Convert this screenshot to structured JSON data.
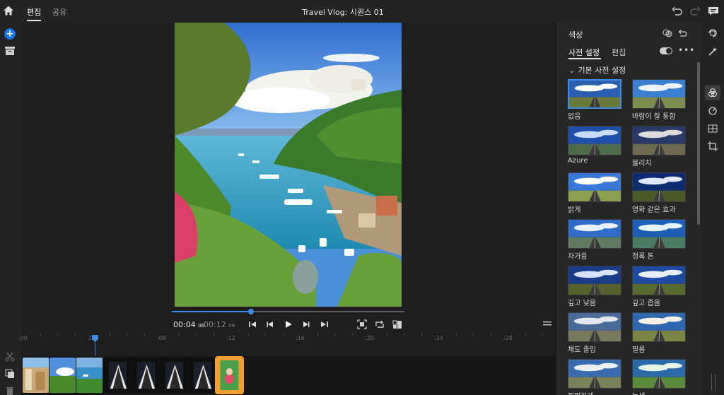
{
  "header": {
    "tabs": [
      {
        "label": "편집",
        "active": true
      },
      {
        "label": "공유",
        "active": false
      }
    ],
    "title": "Travel Vlog: 시퀀스 01"
  },
  "player": {
    "current_time": "00:04",
    "current_frames": "06",
    "total_time": "00:12",
    "total_frames": "09",
    "progress": 0.34
  },
  "timeline": {
    "ruler_labels": [
      ":00",
      ":04",
      ":08",
      ":12",
      ":16",
      ":20",
      ":24",
      ":28"
    ],
    "clips": [
      {
        "kind": "village"
      },
      {
        "kind": "coast"
      },
      {
        "kind": "harbor"
      },
      {
        "kind": "road"
      },
      {
        "kind": "road"
      },
      {
        "kind": "road"
      },
      {
        "kind": "road"
      },
      {
        "kind": "portrait",
        "selected": true
      }
    ]
  },
  "panel": {
    "title": "색상",
    "tabs": [
      {
        "label": "사전 설정",
        "active": true
      },
      {
        "label": "편집",
        "active": false
      }
    ],
    "section": "기본 사전 설정",
    "presets": [
      {
        "label": "없음",
        "selected": true,
        "sky": "#2b5fb0",
        "cloud": "#ffffff",
        "ground": "#6a7a3a"
      },
      {
        "label": "바람이 잘 통함",
        "sky": "#3a7fd0",
        "cloud": "#eef4ff",
        "ground": "#7d8c50"
      },
      {
        "label": "Azure",
        "sky": "#1f4fa8",
        "cloud": "#c9dcff",
        "ground": "#4f6a4a"
      },
      {
        "label": "블리치",
        "sky": "#2a3a68",
        "cloud": "#dcdcdc",
        "ground": "#6e6a50"
      },
      {
        "label": "밝게",
        "sky": "#3a78d8",
        "cloud": "#ffffff",
        "ground": "#8aa050"
      },
      {
        "label": "영화 같은 효과",
        "sky": "#0e2a70",
        "cloud": "#e0e8ff",
        "ground": "#4a5a2a"
      },
      {
        "label": "차가움",
        "sky": "#2e6cc8",
        "cloud": "#eaf2ff",
        "ground": "#5f7a60"
      },
      {
        "label": "청록 톤",
        "sky": "#1f5fb8",
        "cloud": "#e6f4ff",
        "ground": "#4a7a60"
      },
      {
        "label": "깊고 낮음",
        "sky": "#1a3c88",
        "cloud": "#d8e2f8",
        "ground": "#55602e"
      },
      {
        "label": "깊고 좁음",
        "sky": "#1e4aa0",
        "cloud": "#e8eef8",
        "ground": "#5a6a30"
      },
      {
        "label": "채도 줄임",
        "sky": "#4a6a98",
        "cloud": "#e4e8ee",
        "ground": "#7a7a5e"
      },
      {
        "label": "필름",
        "sky": "#2f68b0",
        "cloud": "#f4f0e4",
        "ground": "#7c8446"
      },
      {
        "label": "평평하게",
        "sky": "#3a6ab0",
        "cloud": "#eef0f4",
        "ground": "#7a8258"
      },
      {
        "label": "녹색",
        "sky": "#2a6aa8",
        "cloud": "#e8f4e8",
        "ground": "#5a8a3a"
      }
    ]
  },
  "colors": {
    "accent": "#1473e6",
    "playhead": "#3d8ee8",
    "selected_clip": "#f0a030"
  }
}
